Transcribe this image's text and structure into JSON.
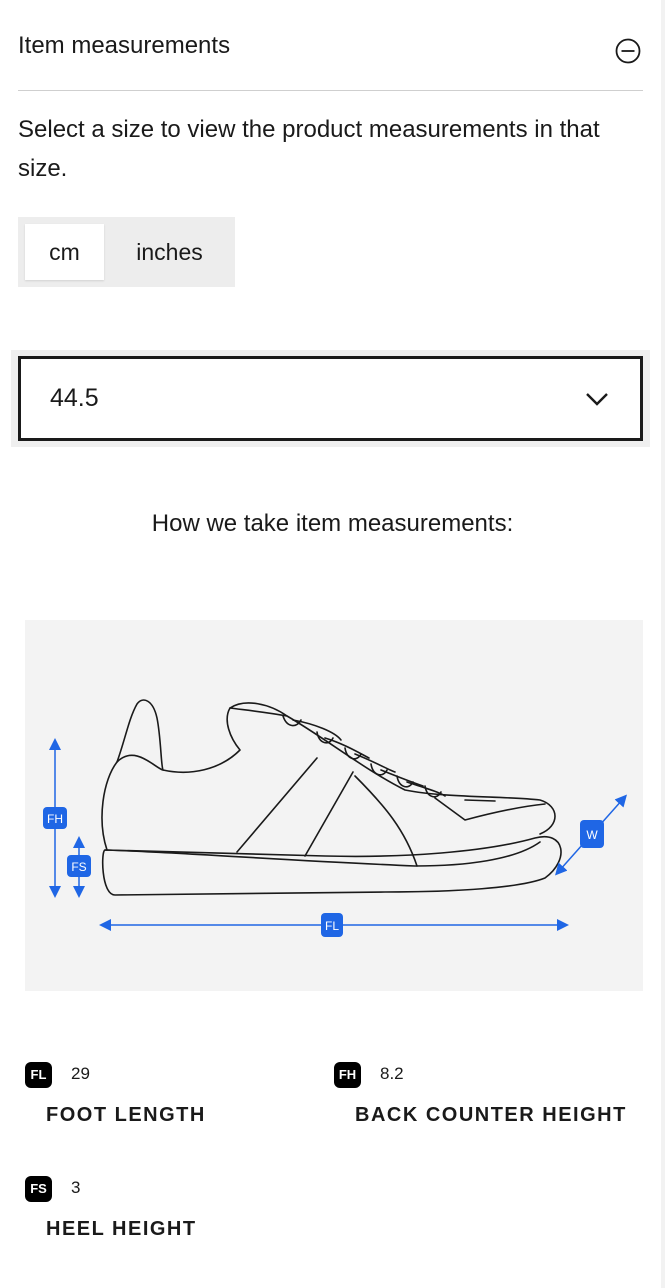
{
  "header": {
    "title": "Item measurements"
  },
  "intro_text": "Select a size to view the product measurements in that size.",
  "unit_toggle": {
    "options": [
      "cm",
      "inches"
    ],
    "selected": "cm"
  },
  "size_select": {
    "value": "44.5"
  },
  "diagram": {
    "title": "How we take item measurements:",
    "labels": {
      "foot_length": "FL",
      "back_counter_height": "FH",
      "heel_height": "FS",
      "width": "W"
    }
  },
  "measurements": [
    {
      "code": "FL",
      "value": "29",
      "label": "FOOT LENGTH"
    },
    {
      "code": "FH",
      "value": "8.2",
      "label": "BACK COUNTER HEIGHT"
    },
    {
      "code": "FS",
      "value": "3",
      "label": "HEEL HEIGHT"
    }
  ],
  "colors": {
    "accent": "#1f66e5",
    "text": "#1a1a1a",
    "badge": "#000000",
    "diagram_bg": "#f3f3f3"
  },
  "icons": {
    "collapse": "minus-circle-icon",
    "dropdown": "chevron-down-icon"
  }
}
